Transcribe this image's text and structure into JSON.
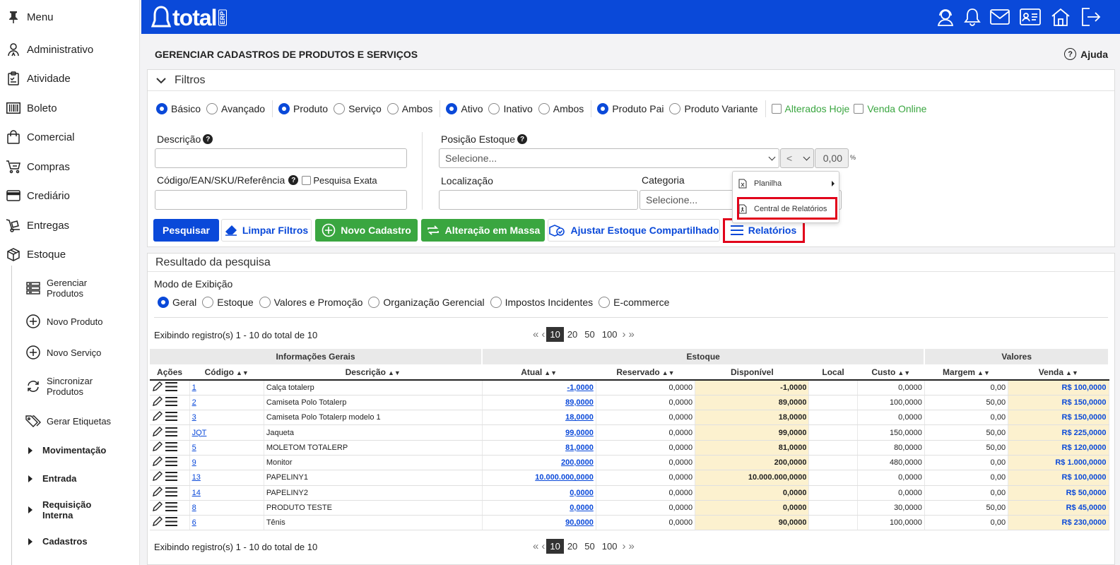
{
  "sidebar": {
    "items": [
      {
        "label": "Menu",
        "icon": "pin-icon"
      },
      {
        "label": "Administrativo",
        "icon": "users-icon"
      },
      {
        "label": "Atividade",
        "icon": "clipboard-icon"
      },
      {
        "label": "Boleto",
        "icon": "barcode-icon"
      },
      {
        "label": "Comercial",
        "icon": "bag-icon"
      },
      {
        "label": "Compras",
        "icon": "cart-icon"
      },
      {
        "label": "Crediário",
        "icon": "card-icon"
      },
      {
        "label": "Entregas",
        "icon": "dolly-icon"
      },
      {
        "label": "Estoque",
        "icon": "box-icon"
      }
    ],
    "subitems": [
      {
        "label1": "Gerenciar",
        "label2": "Produtos",
        "icon": "list-icon"
      },
      {
        "label1": "Novo Produto",
        "label2": "",
        "icon": "plus-circle-icon"
      },
      {
        "label1": "Novo Serviço",
        "label2": "",
        "icon": "plus-circle-icon"
      },
      {
        "label1": "Sincronizar",
        "label2": "Produtos",
        "icon": "sync-icon"
      },
      {
        "label1": "Gerar Etiquetas",
        "label2": "",
        "icon": "tags-icon"
      }
    ],
    "groups": [
      {
        "label1": "Movimentação",
        "label2": ""
      },
      {
        "label1": "Entrada",
        "label2": ""
      },
      {
        "label1": "Requisição",
        "label2": "Interna"
      },
      {
        "label1": "Cadastros",
        "label2": ""
      }
    ]
  },
  "topbar": {
    "logo_text": "total",
    "logo_suffix": "ERP",
    "icons": [
      "support-icon",
      "bell-icon",
      "mail-icon",
      "id-card-icon",
      "home-icon",
      "logout-icon"
    ]
  },
  "header": {
    "title": "GERENCIAR CADASTROS DE PRODUTOS E SERVIÇOS",
    "help": "Ajuda"
  },
  "filters": {
    "title": "Filtros",
    "radio_groups": [
      {
        "options": [
          "Básico",
          "Avançado"
        ],
        "selected": 0
      },
      {
        "options": [
          "Produto",
          "Serviço",
          "Ambos"
        ],
        "selected": 0
      },
      {
        "options": [
          "Ativo",
          "Inativo",
          "Ambos"
        ],
        "selected": 0
      },
      {
        "options": [
          "Produto Pai",
          "Produto Variante"
        ],
        "selected": 0
      }
    ],
    "checks": [
      "Alterados Hoje",
      "Venda Online"
    ],
    "descricao_label": "Descrição",
    "codigo_label": "Código/EAN/SKU/Referência",
    "pesquisa_exata": "Pesquisa Exata",
    "posicao_label": "Posição Estoque",
    "posicao_value": "Selecione...",
    "operator": "<",
    "percent_value": "0,00",
    "percent_sign": "%",
    "localizacao_label": "Localização",
    "categoria_label": "Categoria",
    "categoria_value": "Selecione..."
  },
  "buttons": {
    "pesquisar": "Pesquisar",
    "limpar": "Limpar Filtros",
    "novo": "Novo Cadastro",
    "alteracao": "Alteração em Massa",
    "ajustar": "Ajustar Estoque Compartilhado",
    "relatorios": "Relatórios"
  },
  "reports_menu": {
    "planilha": "Planilha",
    "central": "Central de Relatórios"
  },
  "results": {
    "title": "Resultado da pesquisa",
    "modo_label": "Modo de Exibição",
    "modes": [
      "Geral",
      "Estoque",
      "Valores e Promoção",
      "Organização Gerencial",
      "Impostos Incidentes",
      "E-commerce"
    ],
    "mode_selected": 0,
    "summary": "Exibindo registro(s) 1 - 10 do total de 10",
    "page_sizes": [
      "10",
      "20",
      "50",
      "100"
    ],
    "page_size_selected": 0,
    "groups": [
      "Informações Gerais",
      "Estoque",
      "Valores"
    ],
    "columns": [
      "Ações",
      "Código",
      "Descrição",
      "Atual",
      "Reservado",
      "Disponível",
      "Local",
      "Custo",
      "Margem",
      "Venda"
    ],
    "rows": [
      {
        "codigo": "1",
        "descricao": "Calça totalerp",
        "atual": "-1,0000",
        "reservado": "0,0000",
        "disponivel": "-1,0000",
        "local": "",
        "custo": "0,0000",
        "margem": "0,00",
        "venda": "R$ 100,0000"
      },
      {
        "codigo": "2",
        "descricao": "Camiseta Polo Totalerp",
        "atual": "89,0000",
        "reservado": "0,0000",
        "disponivel": "89,0000",
        "local": "",
        "custo": "100,0000",
        "margem": "50,00",
        "venda": "R$ 150,0000"
      },
      {
        "codigo": "3",
        "descricao": "Camiseta Polo Totalerp modelo 1",
        "atual": "18,0000",
        "reservado": "0,0000",
        "disponivel": "18,0000",
        "local": "",
        "custo": "0,0000",
        "margem": "0,00",
        "venda": "R$ 150,0000"
      },
      {
        "codigo": "JQT",
        "descricao": "Jaqueta",
        "atual": "99,0000",
        "reservado": "0,0000",
        "disponivel": "99,0000",
        "local": "",
        "custo": "150,0000",
        "margem": "50,00",
        "venda": "R$ 225,0000"
      },
      {
        "codigo": "5",
        "descricao": "MOLETOM TOTALERP",
        "atual": "81,0000",
        "reservado": "0,0000",
        "disponivel": "81,0000",
        "local": "",
        "custo": "80,0000",
        "margem": "50,00",
        "venda": "R$ 120,0000"
      },
      {
        "codigo": "9",
        "descricao": "Monitor",
        "atual": "200,0000",
        "reservado": "0,0000",
        "disponivel": "200,0000",
        "local": "",
        "custo": "480,0000",
        "margem": "0,00",
        "venda": "R$ 1.000,0000"
      },
      {
        "codigo": "13",
        "descricao": "PAPELINY1",
        "atual": "10.000.000,0000",
        "reservado": "0,0000",
        "disponivel": "10.000.000,0000",
        "local": "",
        "custo": "0,0000",
        "margem": "0,00",
        "venda": "R$ 100,0000"
      },
      {
        "codigo": "14",
        "descricao": "PAPELINY2",
        "atual": "0,0000",
        "reservado": "0,0000",
        "disponivel": "0,0000",
        "local": "",
        "custo": "0,0000",
        "margem": "0,00",
        "venda": "R$ 50,0000"
      },
      {
        "codigo": "8",
        "descricao": "PRODUTO TESTE",
        "atual": "0,0000",
        "reservado": "0,0000",
        "disponivel": "0,0000",
        "local": "",
        "custo": "30,0000",
        "margem": "50,00",
        "venda": "R$ 45,0000"
      },
      {
        "codigo": "6",
        "descricao": "Tênis",
        "atual": "90,0000",
        "reservado": "0,0000",
        "disponivel": "90,0000",
        "local": "",
        "custo": "100,0000",
        "margem": "0,00",
        "venda": "R$ 230,0000"
      }
    ]
  },
  "colors": {
    "primary": "#0a49d9",
    "green": "#3aa640",
    "highlight": "#fcf1cf",
    "red_box": "#e1001a"
  }
}
